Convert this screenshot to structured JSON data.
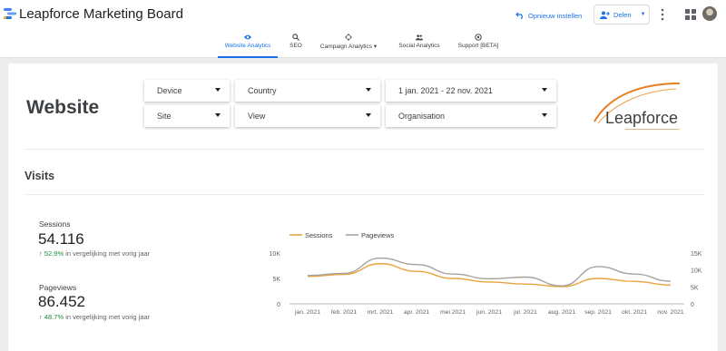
{
  "app": {
    "title": "Leapforce Marketing Board"
  },
  "header": {
    "reset_label": "Opnieuw instellen",
    "share_label": "Delen"
  },
  "tabs": [
    {
      "label": "Website Analytics",
      "icon": "eye-icon",
      "active": true
    },
    {
      "label": "SEO",
      "icon": "search-icon",
      "active": false
    },
    {
      "label": "Campaign Analytics",
      "icon": "target-icon",
      "active": false,
      "has_dropdown": true
    },
    {
      "label": "Social Analytics",
      "icon": "people-icon",
      "active": false
    },
    {
      "label": "Support [BETA]",
      "icon": "support-icon",
      "active": false
    }
  ],
  "page": {
    "title": "Website"
  },
  "filters": {
    "device": "Device",
    "country": "Country",
    "date_range": "1 jan. 2021 - 22 nov. 2021",
    "site": "Site",
    "view": "View",
    "organisation": "Organisation"
  },
  "brand": {
    "name": "Leapforce",
    "primary_color": "#e67e22"
  },
  "visits": {
    "section_title": "Visits",
    "sessions": {
      "label": "Sessions",
      "value": "54.116",
      "delta": "52.9%",
      "delta_text": " in vergelijking met vorig jaar"
    },
    "pageviews": {
      "label": "Pageviews",
      "value": "86.452",
      "delta": "48.7%",
      "delta_text": " in vergelijking met vorig jaar"
    }
  },
  "chart_data": {
    "type": "line",
    "categories": [
      "jan. 2021",
      "feb. 2021",
      "mrt. 2021",
      "apr. 2021",
      "mei 2021",
      "jun. 2021",
      "jul. 2021",
      "aug. 2021",
      "sep. 2021",
      "okt. 2021",
      "nov. 2021"
    ],
    "series": [
      {
        "name": "Sessions",
        "axis": "left",
        "color": "#e8a33d",
        "values": [
          5400,
          5800,
          7900,
          6400,
          5000,
          4300,
          3900,
          3400,
          5000,
          4400,
          3700
        ]
      },
      {
        "name": "Pageviews",
        "axis": "right",
        "color": "#a8a29e",
        "values": [
          8400,
          9000,
          13500,
          11600,
          8800,
          7400,
          7900,
          5300,
          11000,
          8800,
          6700
        ]
      }
    ],
    "y_left": {
      "ticks": [
        "10K",
        "5K",
        "0"
      ],
      "range": [
        0,
        10000
      ]
    },
    "y_right": {
      "ticks": [
        "15K",
        "10K",
        "5K",
        "0"
      ],
      "range": [
        0,
        15000
      ]
    },
    "legend_position": "top-left",
    "grid": false
  }
}
